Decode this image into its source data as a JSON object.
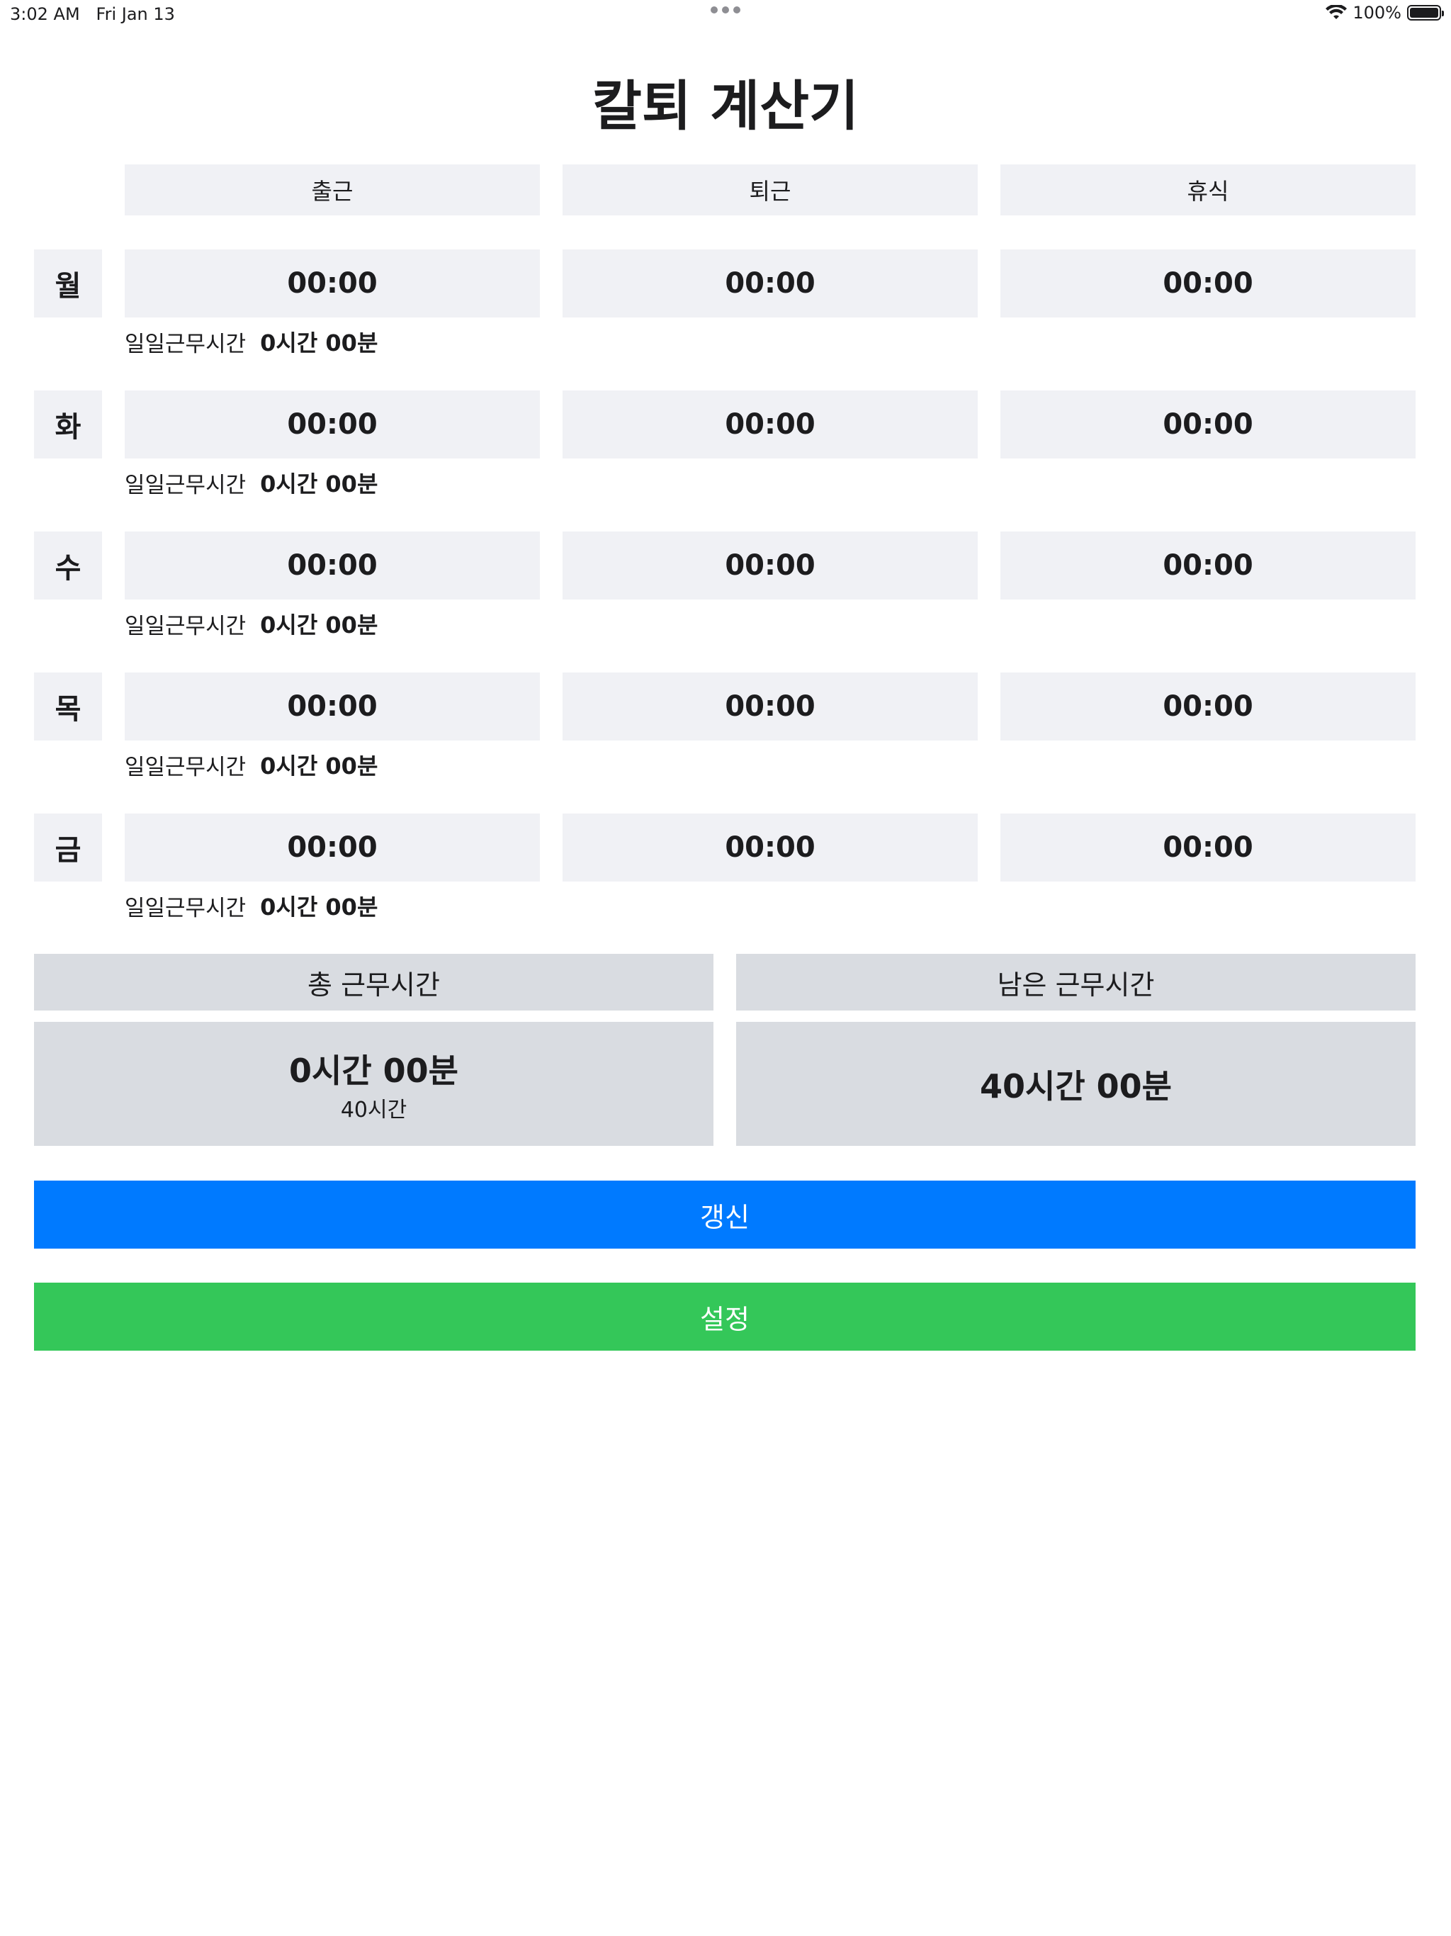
{
  "status_bar": {
    "time": "3:02 AM",
    "date": "Fri Jan 13",
    "battery": "100%"
  },
  "title": "칼퇴 계산기",
  "columns": {
    "start": "출근",
    "end": "퇴근",
    "rest": "휴식"
  },
  "daily_label": "일일근무시간",
  "days": [
    {
      "name": "월",
      "start": "00:00",
      "end": "00:00",
      "rest": "00:00",
      "daily": "0시간 00분"
    },
    {
      "name": "화",
      "start": "00:00",
      "end": "00:00",
      "rest": "00:00",
      "daily": "0시간 00분"
    },
    {
      "name": "수",
      "start": "00:00",
      "end": "00:00",
      "rest": "00:00",
      "daily": "0시간 00분"
    },
    {
      "name": "목",
      "start": "00:00",
      "end": "00:00",
      "rest": "00:00",
      "daily": "0시간 00분"
    },
    {
      "name": "금",
      "start": "00:00",
      "end": "00:00",
      "rest": "00:00",
      "daily": "0시간 00분"
    }
  ],
  "summary": {
    "total_label": "총 근무시간",
    "total_value": "0시간 00분",
    "total_goal": "40시간",
    "remaining_label": "남은 근무시간",
    "remaining_value": "40시간 00분"
  },
  "buttons": {
    "refresh": "갱신",
    "settings": "설정"
  },
  "colors": {
    "refresh": "#007aff",
    "settings": "#34c759",
    "cell": "#f0f1f5",
    "summary": "#d9dce1"
  }
}
